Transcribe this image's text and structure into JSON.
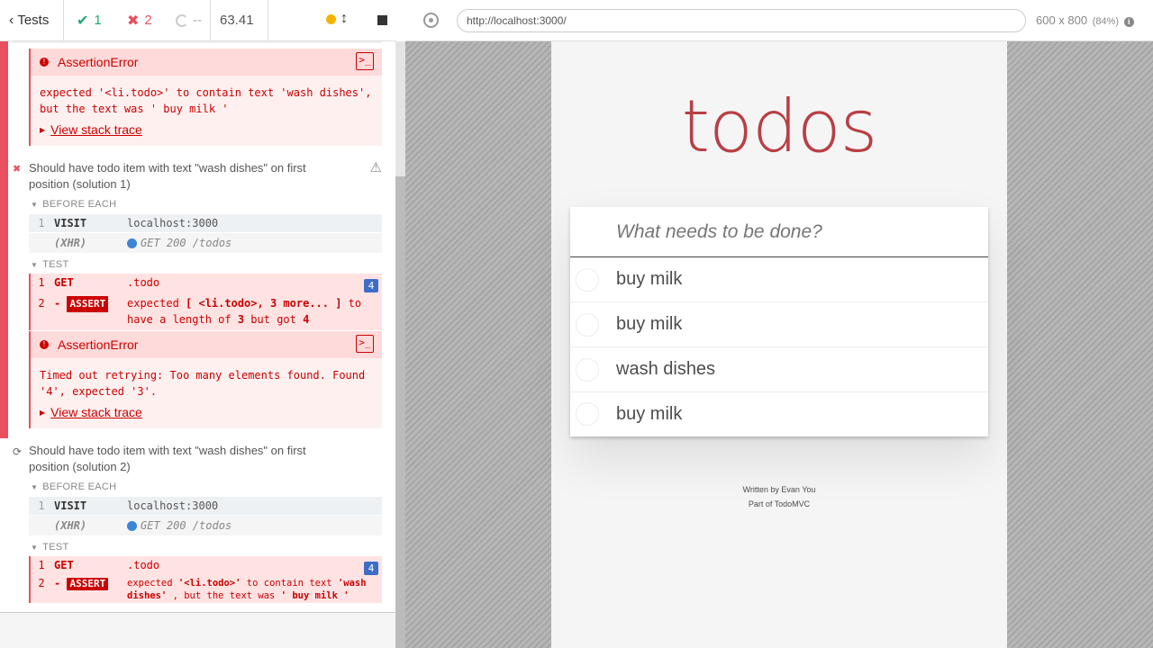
{
  "reporter": {
    "tests_label": "Tests",
    "passed": "1",
    "failed": "2",
    "pending": "--",
    "duration": "63.41"
  },
  "error1": {
    "title": "AssertionError",
    "message": "expected '<li.todo>' to contain text 'wash dishes', but the text was ' buy milk '",
    "stack_link": "View stack trace"
  },
  "test1": {
    "title": "Should have todo item with text \"wash dishes\" on first position (solution 1)",
    "before_each_label": "BEFORE EACH",
    "visit": {
      "num": "1",
      "name": "VISIT",
      "msg": "localhost:3000"
    },
    "xhr": {
      "name": "(XHR)",
      "msg": "GET 200 /todos"
    },
    "test_label": "TEST",
    "get": {
      "num": "1",
      "name": "GET",
      "msg": ".todo",
      "count": "4"
    },
    "assert": {
      "num": "2",
      "name": "ASSERT",
      "msg_parts": [
        "expected",
        "[ <li.todo>, 3 more... ]",
        "to have a length of",
        "3",
        "but got",
        "4"
      ]
    }
  },
  "error2": {
    "title": "AssertionError",
    "message": "Timed out retrying: Too many elements found. Found '4', expected '3'.",
    "stack_link": "View stack trace"
  },
  "test2": {
    "title": "Should have todo item with text \"wash dishes\" on first position (solution 2)",
    "before_each_label": "BEFORE EACH",
    "visit": {
      "num": "1",
      "name": "VISIT",
      "msg": "localhost:3000"
    },
    "xhr": {
      "name": "(XHR)",
      "msg": "GET 200 /todos"
    },
    "test_label": "TEST",
    "get": {
      "num": "1",
      "name": "GET",
      "msg": ".todo",
      "count": "4"
    },
    "assert": {
      "num": "2",
      "name": "ASSERT",
      "msg_parts": [
        "expected",
        "'<li.todo>'",
        "to contain text",
        "'wash dishes'",
        ", but the text was",
        "' buy milk '"
      ]
    }
  },
  "browser": {
    "url": "http://localhost:3000/",
    "viewport": "600 x 800",
    "scale": "(84%)"
  },
  "app": {
    "title": "todos",
    "placeholder": "What needs to be done?",
    "todos": [
      "buy milk",
      "buy milk",
      "wash dishes",
      "buy milk"
    ],
    "footer_line1": "Written by Evan You",
    "footer_line2": "Part of TodoMVC"
  },
  "colors": {
    "fail": "#e94f5f",
    "pass": "#1fa971",
    "brand": "#b83f45",
    "badge": "#3d6dc4"
  }
}
